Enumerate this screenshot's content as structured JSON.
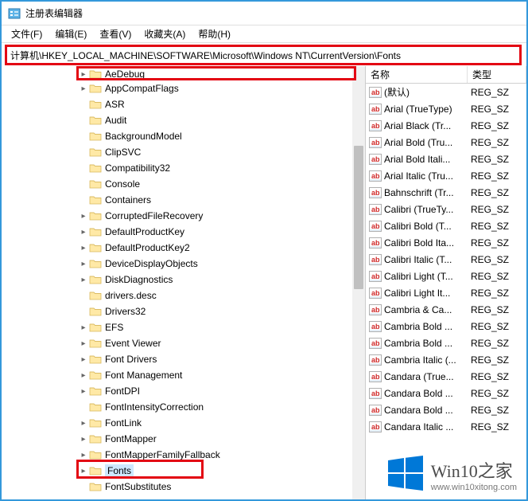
{
  "window": {
    "title": "注册表编辑器"
  },
  "menus": {
    "file": "文件(F)",
    "edit": "编辑(E)",
    "view": "查看(V)",
    "favorites": "收藏夹(A)",
    "help": "帮助(H)"
  },
  "address": "计算机\\HKEY_LOCAL_MACHINE\\SOFTWARE\\Microsoft\\Windows NT\\CurrentVersion\\Fonts",
  "tree": {
    "topClipped": "AeDebug",
    "items": [
      "AppCompatFlags",
      "ASR",
      "Audit",
      "BackgroundModel",
      "ClipSVC",
      "Compatibility32",
      "Console",
      "Containers",
      "CorruptedFileRecovery",
      "DefaultProductKey",
      "DefaultProductKey2",
      "DeviceDisplayObjects",
      "DiskDiagnostics",
      "drivers.desc",
      "Drivers32",
      "EFS",
      "Event Viewer",
      "Font Drivers",
      "Font Management",
      "FontDPI",
      "FontIntensityCorrection",
      "FontLink",
      "FontMapper",
      "FontMapperFamilyFallback",
      "Fonts",
      "FontSubstitutes"
    ],
    "expandable": [
      "AppCompatFlags",
      "CorruptedFileRecovery",
      "DefaultProductKey",
      "DefaultProductKey2",
      "DeviceDisplayObjects",
      "DiskDiagnostics",
      "EFS",
      "Event Viewer",
      "Font Drivers",
      "Font Management",
      "FontDPI",
      "FontLink",
      "FontMapper",
      "FontMapperFamilyFallback",
      "Fonts"
    ],
    "selected": "Fonts"
  },
  "list": {
    "headers": {
      "name": "名称",
      "type": "类型"
    },
    "items": [
      {
        "name": "(默认)",
        "type": "REG_SZ"
      },
      {
        "name": "Arial (TrueType)",
        "type": "REG_SZ"
      },
      {
        "name": "Arial Black (Tr...",
        "type": "REG_SZ"
      },
      {
        "name": "Arial Bold (Tru...",
        "type": "REG_SZ"
      },
      {
        "name": "Arial Bold Itali...",
        "type": "REG_SZ"
      },
      {
        "name": "Arial Italic (Tru...",
        "type": "REG_SZ"
      },
      {
        "name": "Bahnschrift (Tr...",
        "type": "REG_SZ"
      },
      {
        "name": "Calibri (TrueTy...",
        "type": "REG_SZ"
      },
      {
        "name": "Calibri Bold (T...",
        "type": "REG_SZ"
      },
      {
        "name": "Calibri Bold Ita...",
        "type": "REG_SZ"
      },
      {
        "name": "Calibri Italic (T...",
        "type": "REG_SZ"
      },
      {
        "name": "Calibri Light (T...",
        "type": "REG_SZ"
      },
      {
        "name": "Calibri Light It...",
        "type": "REG_SZ"
      },
      {
        "name": "Cambria & Ca...",
        "type": "REG_SZ"
      },
      {
        "name": "Cambria Bold ...",
        "type": "REG_SZ"
      },
      {
        "name": "Cambria Bold ...",
        "type": "REG_SZ"
      },
      {
        "name": "Cambria Italic (...",
        "type": "REG_SZ"
      },
      {
        "name": "Candara (True...",
        "type": "REG_SZ"
      },
      {
        "name": "Candara Bold ...",
        "type": "REG_SZ"
      },
      {
        "name": "Candara Bold ...",
        "type": "REG_SZ"
      },
      {
        "name": "Candara Italic ...",
        "type": "REG_SZ"
      }
    ]
  },
  "watermark": {
    "brand": "Win10之家",
    "url": "www.win10xitong.com"
  },
  "colors": {
    "highlight": "#e30613",
    "winBlue": "#0078d7"
  }
}
